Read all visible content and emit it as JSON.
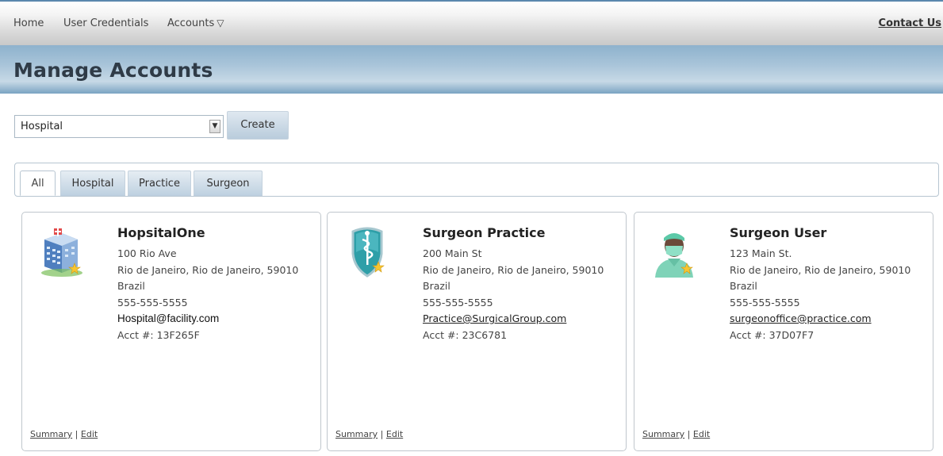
{
  "nav": {
    "home": "Home",
    "credentials": "User Credentials",
    "accounts": "Accounts",
    "contact": "Contact Us"
  },
  "page": {
    "title": "Manage Accounts"
  },
  "filter": {
    "selected": "Hospital",
    "create_label": "Create"
  },
  "tabs": [
    {
      "label": "All"
    },
    {
      "label": "Hospital"
    },
    {
      "label": "Practice"
    },
    {
      "label": "Surgeon"
    }
  ],
  "cards": [
    {
      "icon": "hospital-building-icon",
      "name": "HopsitalOne",
      "address1": "100 Rio Ave",
      "address2": "Rio de Janeiro, Rio de Janeiro, 59010",
      "country": "Brazil",
      "phone": "555-555-5555",
      "email": "Hospital@facility.com",
      "acct": "Acct #: 13F265F",
      "summary": "Summary",
      "edit": "Edit",
      "sep": "|"
    },
    {
      "icon": "medical-shield-icon",
      "name": "Surgeon Practice",
      "address1": "200 Main St",
      "address2": "Rio de Janeiro, Rio de Janeiro, 59010",
      "country": "Brazil",
      "phone": "555-555-5555",
      "email": "Practice@SurgicalGroup.com",
      "acct": "Acct #: 23C6781",
      "summary": "Summary",
      "edit": "Edit",
      "sep": "|"
    },
    {
      "icon": "surgeon-avatar-icon",
      "name": "Surgeon User",
      "address1": "123 Main St.",
      "address2": "Rio de Janeiro, Rio de Janeiro, 59010",
      "country": "Brazil",
      "phone": "555-555-5555",
      "email": "surgeonoffice@practice.com",
      "acct": "Acct #: 37D07F7",
      "summary": "Summary",
      "edit": "Edit",
      "sep": "|"
    }
  ],
  "colors": {
    "nav_border": "#5a87ad",
    "title_bar": "#a8c4d9",
    "tab_inactive": "#bdd0e0",
    "card_border": "#c0c7cd"
  }
}
